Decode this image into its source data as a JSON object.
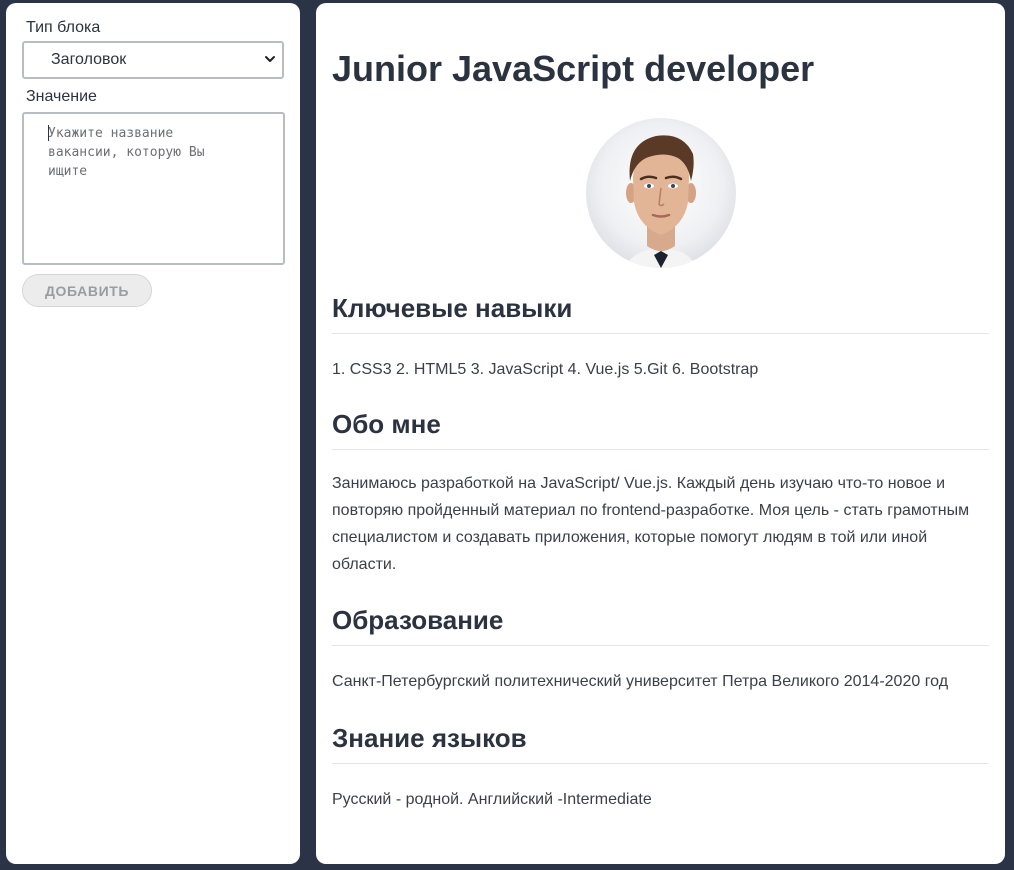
{
  "form": {
    "type_label": "Тип блока",
    "type_selected": "Заголовок",
    "value_label": "Значение",
    "value_placeholder": "Укажите название вакансии, которую Вы ищите",
    "value_placeholder_lines": [
      "Укажите название",
      "вакансии, которую Вы",
      "ищите"
    ],
    "add_button": "ДОБАВИТЬ"
  },
  "resume": {
    "title": "Junior JavaScript developer",
    "sections": [
      {
        "heading": "Ключевые навыки",
        "text": "1. CSS3 2. HTML5 3. JavaScript 4. Vue.js 5.Git 6. Bootstrap"
      },
      {
        "heading": "Обо мне",
        "text": "Занимаюсь разработкой на JavaScript/ Vue.js. Каждый день изучаю что-то новое и повторяю пройденный материал по frontend-разработке. Моя цель - стать грамотным специалистом и создавать приложения, которые помогут людям в той или иной области."
      },
      {
        "heading": "Образование",
        "text": "Санкт-Петербургский политехнический университет Петра Великого 2014-2020 год"
      },
      {
        "heading": "Знание языков",
        "text": "Русский - родной. Английский -Intermediate"
      }
    ]
  },
  "icons": {
    "select_arrow": "chevron-down-icon",
    "avatar": "person-photo"
  },
  "colors": {
    "background": "#2b3446",
    "panel": "#ffffff",
    "text": "#2c3340",
    "button_bg": "#ececec",
    "button_text": "#9a9c9f"
  }
}
